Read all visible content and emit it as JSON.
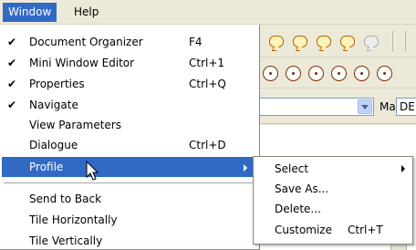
{
  "menubar": {
    "window_label": "Window",
    "help_label": "Help"
  },
  "toolbar": {
    "mat_label": "Mat",
    "mat_value": "DEFA"
  },
  "window_menu": {
    "items": [
      {
        "label": "Document Organizer",
        "shortcut": "F4",
        "checked": "✔"
      },
      {
        "label": "Mini Window Editor",
        "shortcut": "Ctrl+1",
        "checked": "✔"
      },
      {
        "label": "Properties",
        "shortcut": "Ctrl+Q",
        "checked": "✔"
      },
      {
        "label": "Navigate",
        "shortcut": "",
        "checked": "✔"
      },
      {
        "label": "View Parameters",
        "shortcut": "",
        "checked": ""
      },
      {
        "label": "Dialogue",
        "shortcut": "Ctrl+D",
        "checked": ""
      },
      {
        "label": "Profile",
        "shortcut": "",
        "checked": ""
      },
      {
        "label": "Send to Back",
        "shortcut": "",
        "checked": ""
      },
      {
        "label": "Tile Horizontally",
        "shortcut": "",
        "checked": ""
      },
      {
        "label": "Tile Vertically",
        "shortcut": "",
        "checked": ""
      }
    ]
  },
  "profile_submenu": {
    "items": [
      {
        "label": "Select",
        "shortcut": ""
      },
      {
        "label": "Save As...",
        "shortcut": ""
      },
      {
        "label": "Delete...",
        "shortcut": ""
      },
      {
        "label": "Customize",
        "shortcut": "Ctrl+T"
      }
    ]
  },
  "colors": {
    "highlight": "#316ac5",
    "menu_bg": "#ffffff",
    "app_bg": "#ece9d8"
  },
  "icons": {
    "comment": "comment-icon",
    "circle": "circle-tool-icon",
    "dropdown": "chevron-down-icon",
    "submenu_arrow": "chevron-right-icon",
    "checkmark": "check-icon",
    "cursor": "mouse-pointer-icon"
  }
}
